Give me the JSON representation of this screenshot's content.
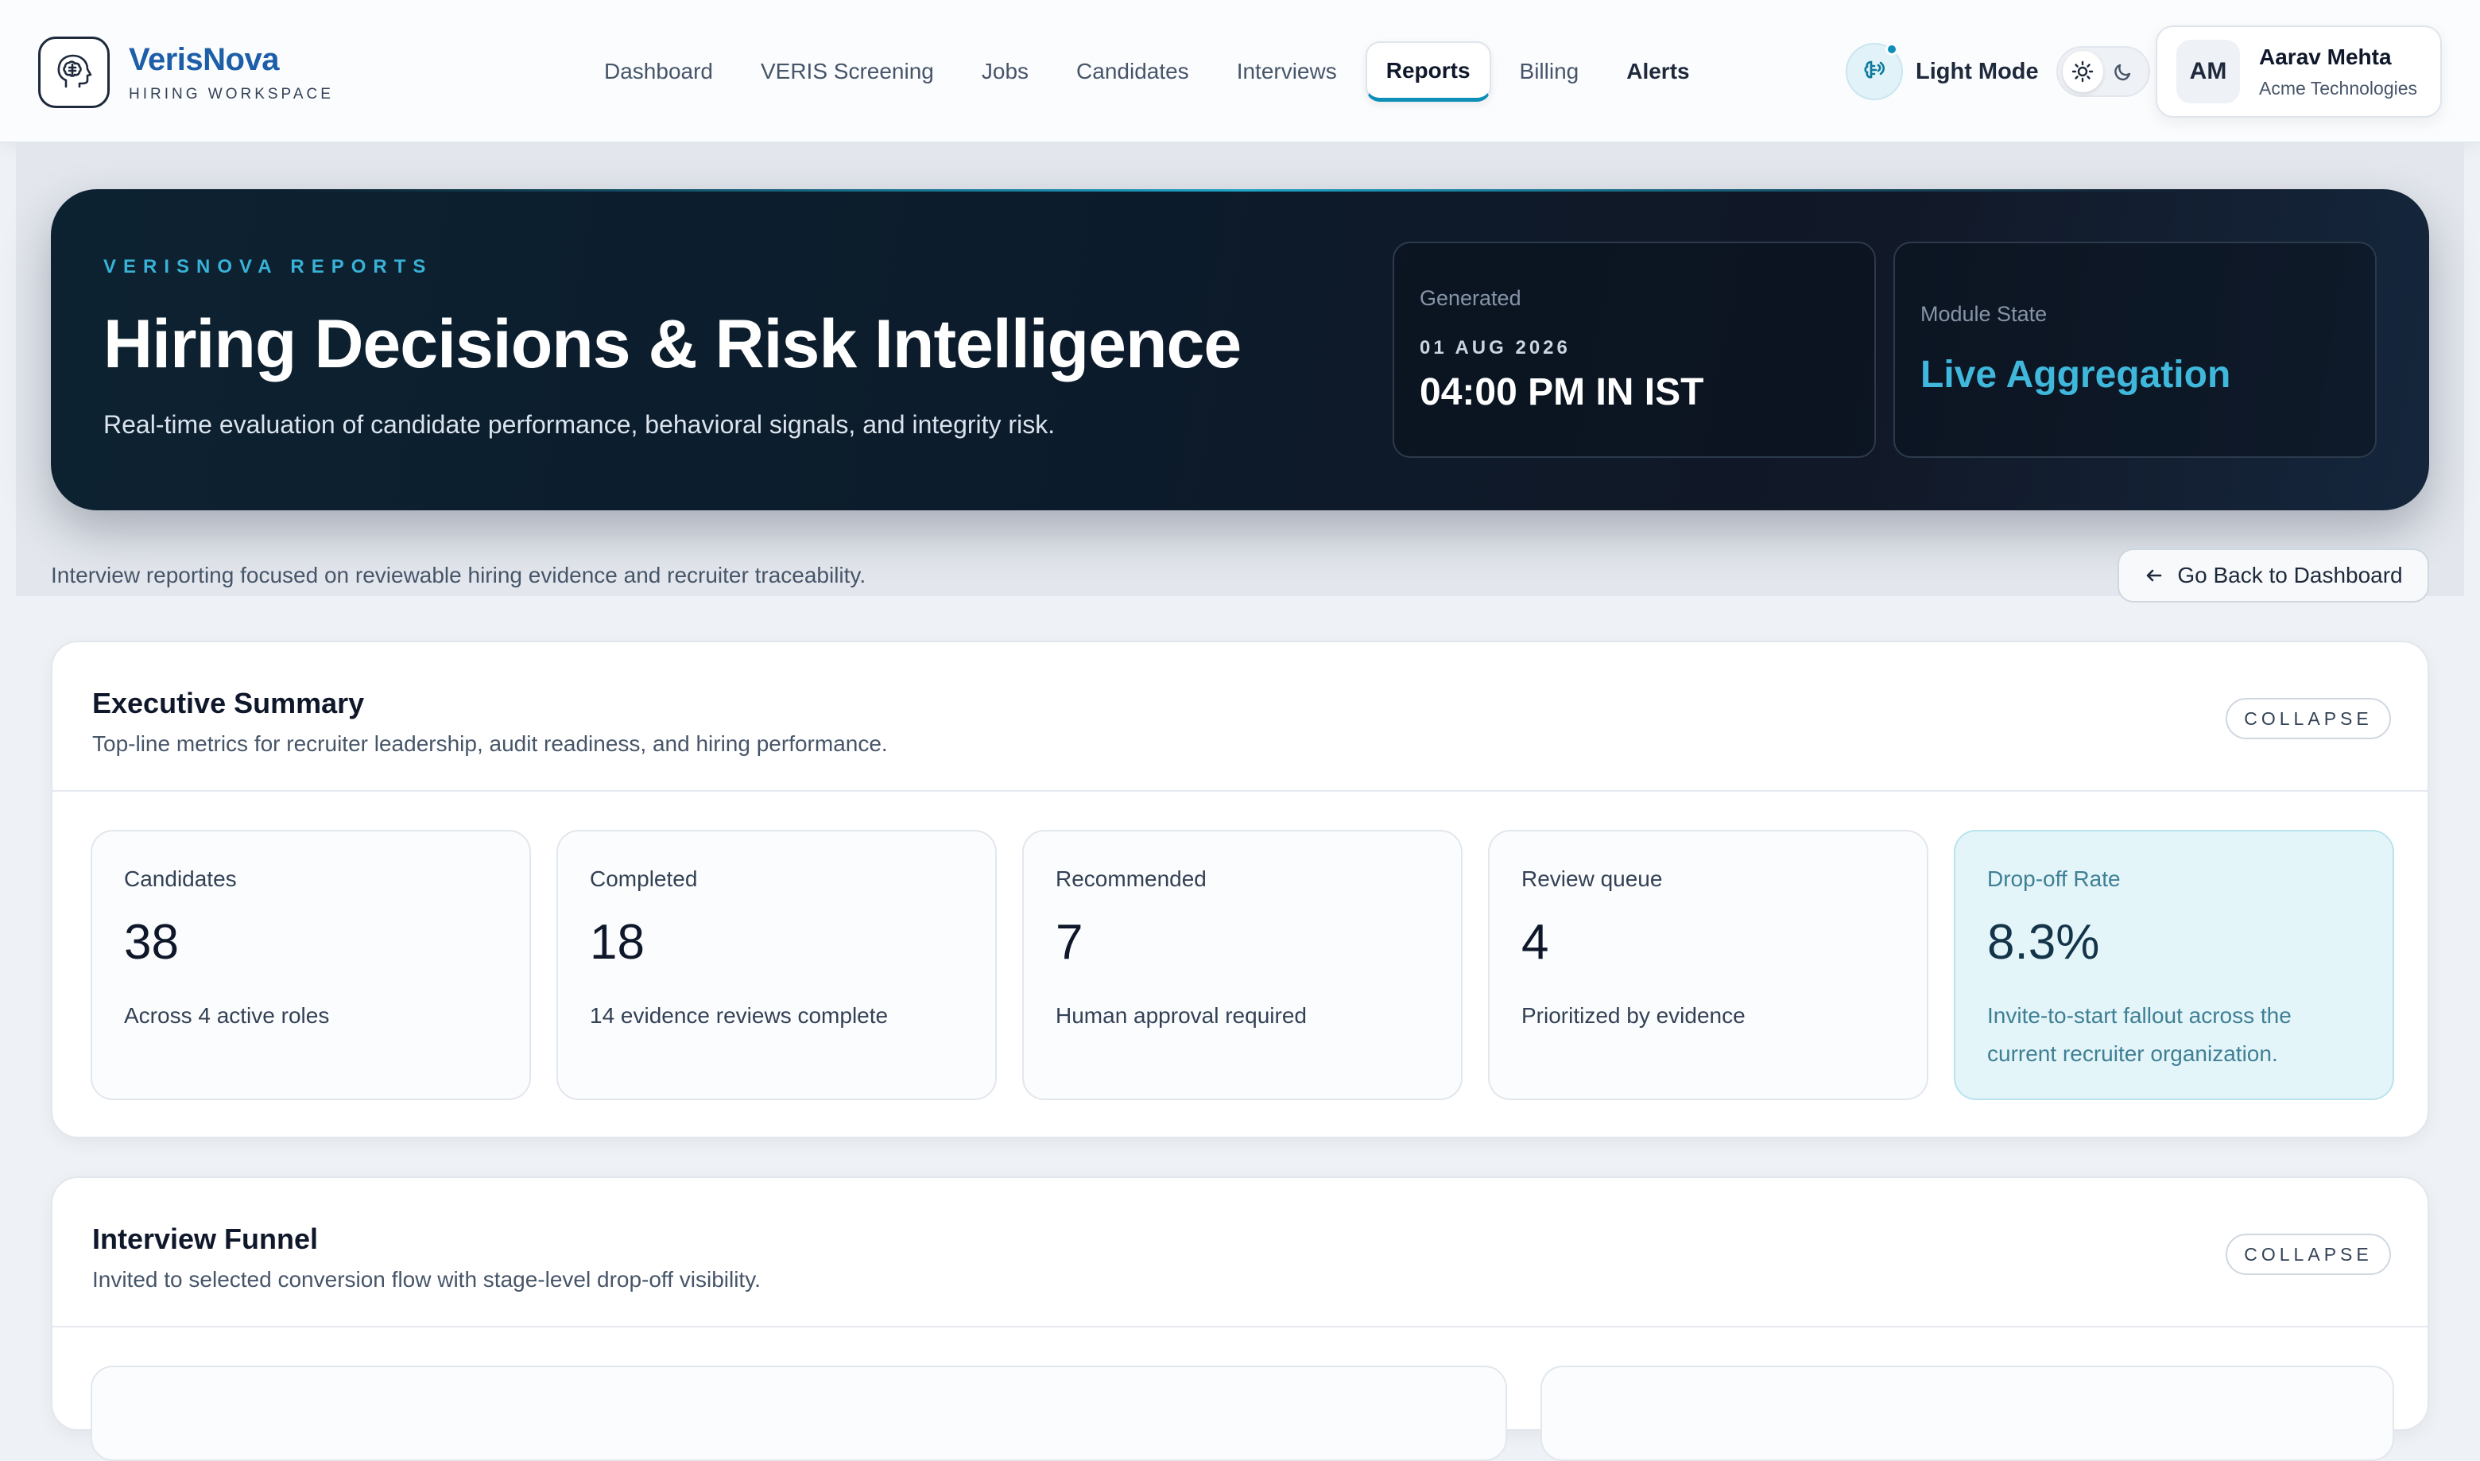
{
  "brand": {
    "name": "VerisNova",
    "subtitle": "HIRING WORKSPACE"
  },
  "nav": {
    "items": [
      {
        "label": "Dashboard"
      },
      {
        "label": "VERIS Screening"
      },
      {
        "label": "Jobs"
      },
      {
        "label": "Candidates"
      },
      {
        "label": "Interviews"
      },
      {
        "label": "Reports"
      },
      {
        "label": "Billing"
      },
      {
        "label": "Alerts"
      }
    ],
    "active": "Reports"
  },
  "mode": {
    "label": "Light Mode"
  },
  "user": {
    "initials": "AM",
    "name": "Aarav Mehta",
    "org": "Acme Technologies"
  },
  "hero": {
    "kicker": "VERISNOVA REPORTS",
    "title": "Hiring Decisions & Risk Intelligence",
    "description": "Real-time evaluation of candidate performance, behavioral signals, and integrity risk.",
    "generated": {
      "label": "Generated",
      "date": "01 AUG 2026",
      "time": "04:00 PM IN IST"
    },
    "module_state": {
      "label": "Module State",
      "value": "Live Aggregation"
    }
  },
  "subline": "Interview reporting focused on reviewable hiring evidence and recruiter traceability.",
  "back_button": "Go Back to Dashboard",
  "summary": {
    "title": "Executive Summary",
    "description": "Top-line metrics for recruiter leadership, audit readiness, and hiring performance.",
    "collapse_label": "COLLAPSE",
    "metrics": [
      {
        "label": "Candidates",
        "value": "38",
        "note": "Across 4 active roles"
      },
      {
        "label": "Completed",
        "value": "18",
        "note": "14 evidence reviews complete"
      },
      {
        "label": "Recommended",
        "value": "7",
        "note": "Human approval required"
      },
      {
        "label": "Review queue",
        "value": "4",
        "note": "Prioritized by evidence"
      },
      {
        "label": "Drop-off Rate",
        "value": "8.3%",
        "note": "Invite-to-start fallout across the current recruiter organization."
      }
    ]
  },
  "funnel": {
    "title": "Interview Funnel",
    "description": "Invited to selected conversion flow with stage-level drop-off visibility.",
    "collapse_label": "COLLAPSE"
  },
  "colors": {
    "accent": "#0e8fb8",
    "brand": "#1d5ea8",
    "hero_bg": "#0c1b2b",
    "highlight_bg": "#e3f5f9"
  },
  "icons": {
    "logo": "brain-head-icon",
    "mode": "brain-signal-icon",
    "sun": "sun-icon",
    "moon": "moon-icon",
    "back": "arrow-left-icon"
  }
}
